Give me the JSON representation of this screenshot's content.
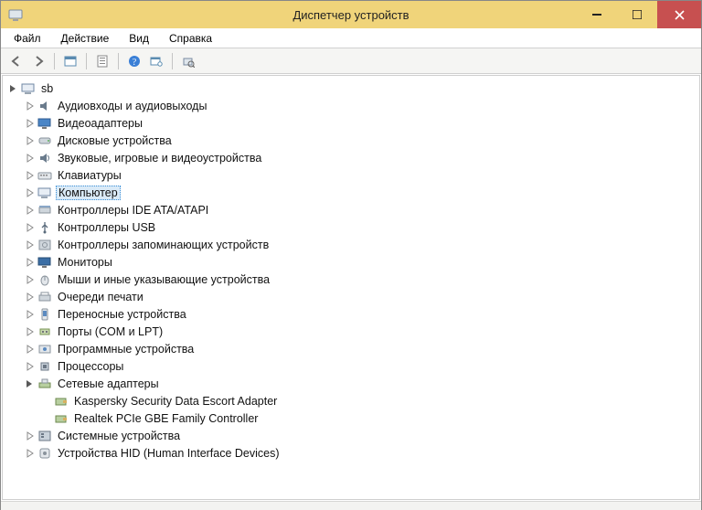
{
  "window": {
    "title": "Диспетчер устройств"
  },
  "menu": {
    "file": "Файл",
    "action": "Действие",
    "view": "Вид",
    "help": "Справка"
  },
  "tree": {
    "root": {
      "label": "sb"
    },
    "items": [
      {
        "label": "Аудиовходы и аудиовыходы",
        "icon": "audio"
      },
      {
        "label": "Видеоадаптеры",
        "icon": "display"
      },
      {
        "label": "Дисковые устройства",
        "icon": "disk"
      },
      {
        "label": "Звуковые, игровые и видеоустройства",
        "icon": "sound"
      },
      {
        "label": "Клавиатуры",
        "icon": "keyboard"
      },
      {
        "label": "Компьютер",
        "icon": "computer",
        "selected": true
      },
      {
        "label": "Контроллеры IDE ATA/ATAPI",
        "icon": "ide"
      },
      {
        "label": "Контроллеры USB",
        "icon": "usb"
      },
      {
        "label": "Контроллеры запоминающих устройств",
        "icon": "storage"
      },
      {
        "label": "Мониторы",
        "icon": "monitor"
      },
      {
        "label": "Мыши и иные указывающие устройства",
        "icon": "mouse"
      },
      {
        "label": "Очереди печати",
        "icon": "printer"
      },
      {
        "label": "Переносные устройства",
        "icon": "portable"
      },
      {
        "label": "Порты (COM и LPT)",
        "icon": "port"
      },
      {
        "label": "Программные устройства",
        "icon": "software"
      },
      {
        "label": "Процессоры",
        "icon": "cpu"
      },
      {
        "label": "Сетевые адаптеры",
        "icon": "network",
        "expanded": true,
        "children": [
          {
            "label": "Kaspersky Security Data Escort Adapter",
            "icon": "netcard"
          },
          {
            "label": "Realtek PCIe GBE Family Controller",
            "icon": "netcard"
          }
        ]
      },
      {
        "label": "Системные устройства",
        "icon": "system"
      },
      {
        "label": "Устройства HID (Human Interface Devices)",
        "icon": "hid"
      }
    ]
  }
}
